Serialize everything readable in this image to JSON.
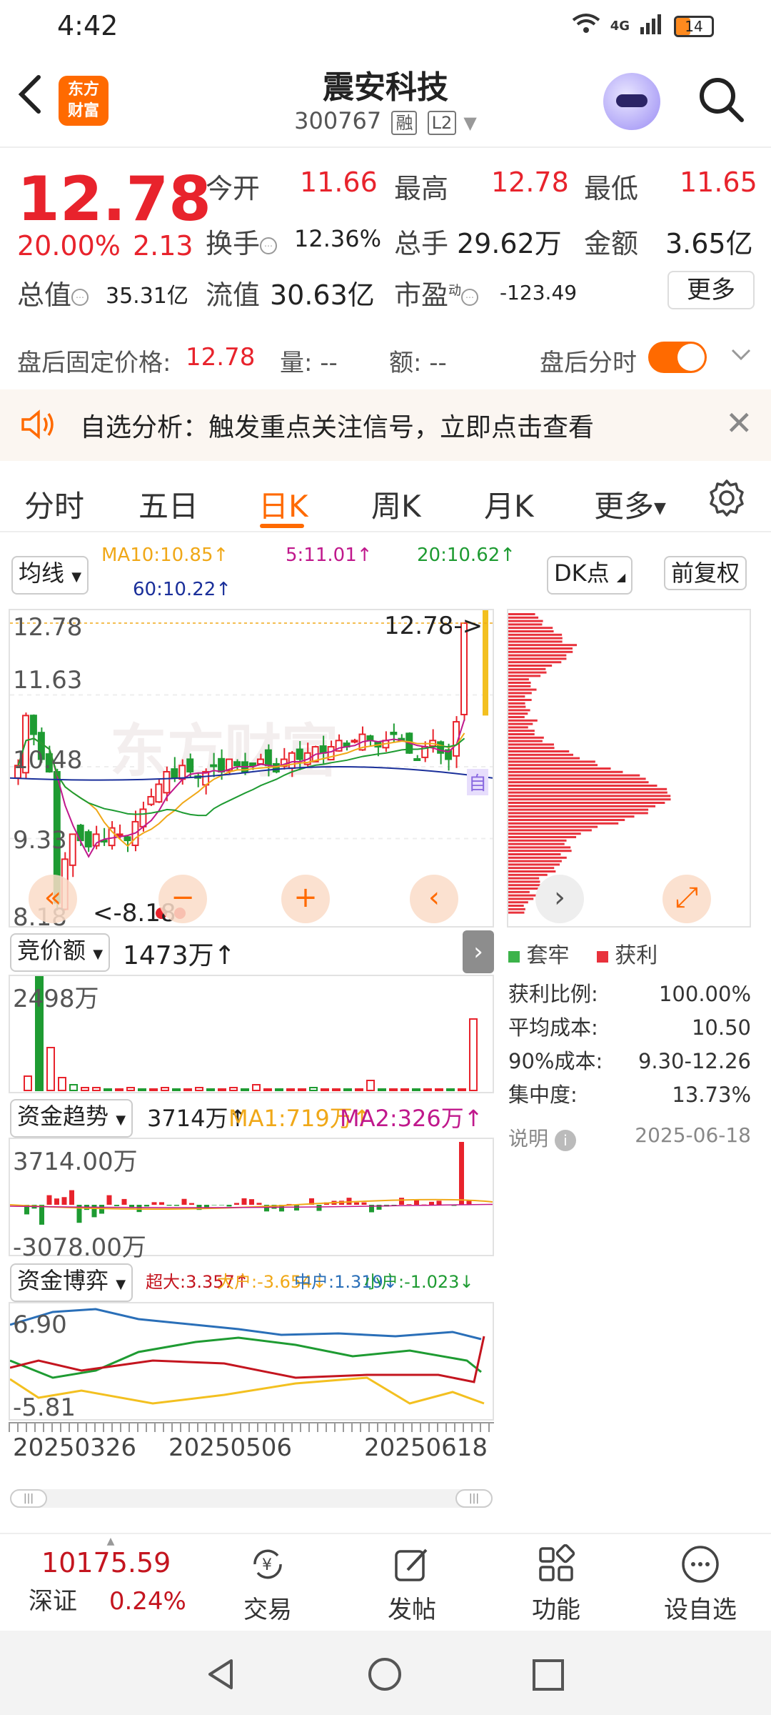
{
  "status": {
    "time": "4:42",
    "network": "4G",
    "battery": "14"
  },
  "header": {
    "brand": [
      "东方",
      "财富"
    ],
    "title": "震安科技",
    "code": "300767",
    "tags": [
      "融",
      "L2"
    ]
  },
  "quote": {
    "price": "12.78",
    "pct": "20.00%",
    "change": "2.13",
    "rows": [
      [
        {
          "label": "今开",
          "value": "11.66",
          "color": "red"
        },
        {
          "label": "最高",
          "value": "12.78",
          "color": "red"
        },
        {
          "label": "最低",
          "value": "11.65",
          "color": "red"
        }
      ],
      [
        {
          "label": "换手",
          "value": "12.36%",
          "color": "dark"
        },
        {
          "label": "总手",
          "value": "29.62万",
          "color": "dark"
        },
        {
          "label": "金额",
          "value": "3.65亿",
          "color": "dark"
        }
      ]
    ],
    "total_value_label": "总值",
    "total_value": "35.31亿",
    "float_label": "流值",
    "float_value": "30.63亿",
    "pe_label": "市盈",
    "pe_sup": "动",
    "pe_value": "-123.49",
    "more": "更多"
  },
  "after_hours": {
    "label": "盘后固定价格:",
    "price": "12.78",
    "vol_label": "量: --",
    "amt_label": "额: --",
    "toggle_label": "盘后分时"
  },
  "banner": {
    "text": "自选分析：触发重点关注信号，立即点击查看"
  },
  "tabs": [
    "分时",
    "五日",
    "日K",
    "周K",
    "月K",
    "更多"
  ],
  "active_tab": "日K",
  "ma": {
    "selector": "均线",
    "ma10": "MA10:10.85↑",
    "ma5": "5:11.01↑",
    "ma20": "20:10.62↑",
    "ma60": "60:10.22↑",
    "dk": "DK点",
    "adjust": "前复权",
    "colors": {
      "ma10": "#f0a818",
      "ma5": "#c0188c",
      "ma20": "#1e9b32",
      "ma60": "#1a2f9a"
    }
  },
  "kline": {
    "y_labels": [
      "12.78",
      "11.63",
      "10.48",
      "9.33",
      "8.18"
    ],
    "last_label": "12.78->",
    "low_label": "<-8.18",
    "watermark": "东方财富",
    "self_tag": "自"
  },
  "auction": {
    "selector": "竞价额",
    "value": "1473万↑",
    "y_top": "2498万"
  },
  "fund_trend": {
    "selector": "资金趋势",
    "value": "3714万↑",
    "ma1": "MA1:719万↑",
    "ma2": "MA2:326万↑",
    "y_top": "3714.00万",
    "y_bottom": "-3078.00万"
  },
  "fund_game": {
    "selector": "资金博弈",
    "super": "超大:3.357↑",
    "large": "大户:-3.654↓",
    "mid": "中户:1.319↓",
    "small": "小户:-1.023↓",
    "y_top": "6.90",
    "y_bottom": "-5.81"
  },
  "dates": [
    "20250326",
    "20250506",
    "20250618"
  ],
  "chip": {
    "legend_trap": "套牢",
    "legend_profit": "获利",
    "stats": [
      {
        "label": "获利比例:",
        "value": "100.00%"
      },
      {
        "label": "平均成本:",
        "value": "10.50"
      },
      {
        "label": "90%成本:",
        "value": "9.30-12.26"
      },
      {
        "label": "集中度:",
        "value": "13.73%"
      }
    ],
    "note": "说明",
    "date": "2025-06-18"
  },
  "index": {
    "value": "10175.59",
    "name": "深证",
    "pct": "0.24%"
  },
  "bottom_nav": [
    "交易",
    "发帖",
    "功能",
    "设自选"
  ]
}
